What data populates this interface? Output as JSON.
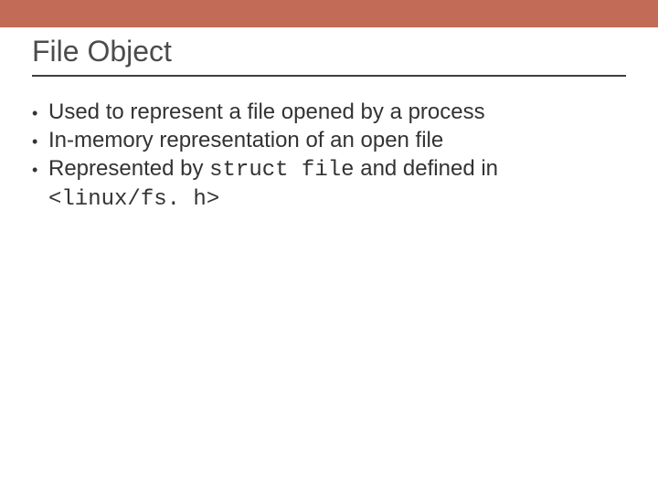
{
  "title": "File Object",
  "bullets": {
    "b1": {
      "dot": "•",
      "pre": "Used to represent a file opened by a process"
    },
    "b2": {
      "dot": "•",
      "pre": "In-memory representation of an open file"
    },
    "b3": {
      "dot": "•",
      "pre": "Represented by ",
      "code1": "struct file",
      "mid": " and defined in ",
      "code2": "<linux/fs. h>"
    }
  },
  "colors": {
    "accent_bar": "#c26b56",
    "rule": "#3e3e3e"
  }
}
